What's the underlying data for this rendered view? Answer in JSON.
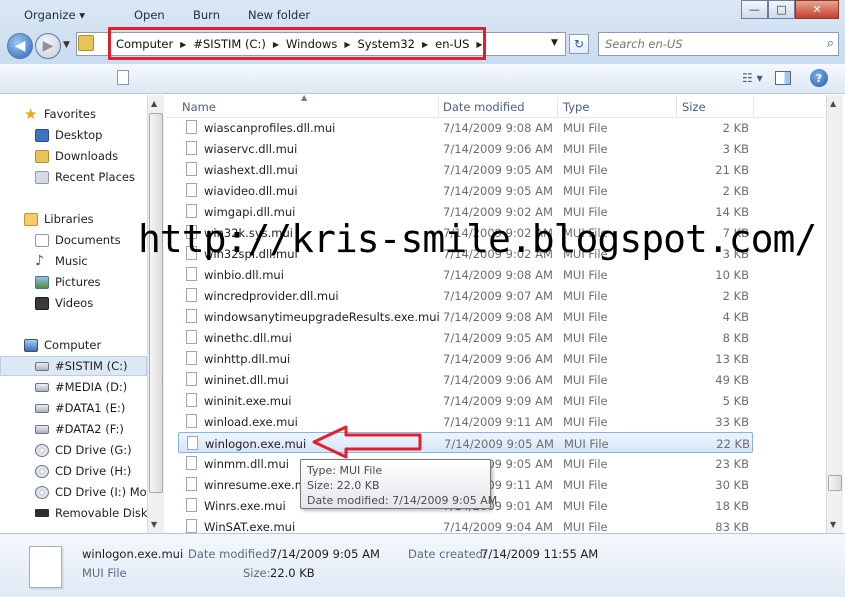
{
  "window": {
    "minimize_glyph": "—",
    "maximize_glyph": "□",
    "close_glyph": "✕"
  },
  "address": {
    "crumbs": [
      "Computer",
      "#SISTIM (C:)",
      "Windows",
      "System32",
      "en-US"
    ],
    "highlight_color": "#e0202c"
  },
  "search": {
    "placeholder": "Search en-US"
  },
  "toolbar": {
    "organize": "Organize",
    "organize_arrow": "▾",
    "open": "Open",
    "burn": "Burn",
    "new_folder": "New folder",
    "help": "?"
  },
  "nav": {
    "favorites": "Favorites",
    "desktop": "Desktop",
    "downloads": "Downloads",
    "recent_places": "Recent Places",
    "libraries": "Libraries",
    "documents": "Documents",
    "music": "Music",
    "pictures": "Pictures",
    "videos": "Videos",
    "computer": "Computer",
    "drive_c": "#SISTIM (C:)",
    "drive_d": "#MEDIA (D:)",
    "drive_e": "#DATA1 (E:)",
    "drive_f": "#DATA2 (F:)",
    "drive_g": "CD Drive (G:)",
    "drive_h": "CD Drive (H:)",
    "drive_i": "CD Drive (I:) Moc",
    "removable": "Removable Disk ("
  },
  "columns": {
    "name": "Name",
    "date_modified": "Date modified",
    "type": "Type",
    "size": "Size"
  },
  "files": [
    {
      "name": "wiascanprofiles.dll.mui",
      "date": "7/14/2009 9:08 AM",
      "type": "MUI File",
      "size": "2 KB"
    },
    {
      "name": "wiaservc.dll.mui",
      "date": "7/14/2009 9:06 AM",
      "type": "MUI File",
      "size": "3 KB"
    },
    {
      "name": "wiashext.dll.mui",
      "date": "7/14/2009 9:05 AM",
      "type": "MUI File",
      "size": "21 KB"
    },
    {
      "name": "wiavideo.dll.mui",
      "date": "7/14/2009 9:05 AM",
      "type": "MUI File",
      "size": "2 KB"
    },
    {
      "name": "wimgapi.dll.mui",
      "date": "7/14/2009 9:02 AM",
      "type": "MUI File",
      "size": "14 KB"
    },
    {
      "name": "win32k.sys.mui",
      "date": "7/14/2009 9:02 AM",
      "type": "MUI File",
      "size": "7 KB"
    },
    {
      "name": "win32spl.dll.mui",
      "date": "7/14/2009 9:02 AM",
      "type": "MUI File",
      "size": "3 KB"
    },
    {
      "name": "winbio.dll.mui",
      "date": "7/14/2009 9:08 AM",
      "type": "MUI File",
      "size": "10 KB"
    },
    {
      "name": "wincredprovider.dll.mui",
      "date": "7/14/2009 9:07 AM",
      "type": "MUI File",
      "size": "2 KB"
    },
    {
      "name": "windowsanytimeupgradeResults.exe.mui",
      "date": "7/14/2009 9:08 AM",
      "type": "MUI File",
      "size": "4 KB"
    },
    {
      "name": "winethc.dll.mui",
      "date": "7/14/2009 9:05 AM",
      "type": "MUI File",
      "size": "8 KB"
    },
    {
      "name": "winhttp.dll.mui",
      "date": "7/14/2009 9:06 AM",
      "type": "MUI File",
      "size": "13 KB"
    },
    {
      "name": "wininet.dll.mui",
      "date": "7/14/2009 9:06 AM",
      "type": "MUI File",
      "size": "49 KB"
    },
    {
      "name": "wininit.exe.mui",
      "date": "7/14/2009 9:09 AM",
      "type": "MUI File",
      "size": "5 KB"
    },
    {
      "name": "winload.exe.mui",
      "date": "7/14/2009 9:11 AM",
      "type": "MUI File",
      "size": "33 KB"
    },
    {
      "name": "winlogon.exe.mui",
      "date": "7/14/2009 9:05 AM",
      "type": "MUI File",
      "size": "22 KB"
    },
    {
      "name": "winmm.dll.mui",
      "date": "7/14/2009 9:05 AM",
      "type": "MUI File",
      "size": "23 KB"
    },
    {
      "name": "winresume.exe.mui",
      "date": "7/14/2009 9:11 AM",
      "type": "MUI File",
      "size": "30 KB"
    },
    {
      "name": "Winrs.exe.mui",
      "date": "7/14/2009 9:01 AM",
      "type": "MUI File",
      "size": "18 KB"
    },
    {
      "name": "WinSAT.exe.mui",
      "date": "7/14/2009 9:04 AM",
      "type": "MUI File",
      "size": "83 KB"
    }
  ],
  "tooltip": {
    "type": "Type: MUI File",
    "size": "Size: 22.0 KB",
    "date": "Date modified: 7/14/2009 9:05 AM"
  },
  "watermark": "http://kris-smile.blogspot.com/",
  "details": {
    "filename": "winlogon.exe.mui",
    "filetype": "MUI File",
    "date_modified_label": "Date modified:",
    "date_modified": "7/14/2009 9:05 AM",
    "date_created_label": "Date created:",
    "date_created": "7/14/2009 11:55 AM",
    "size_label": "Size:",
    "size": "22.0 KB"
  }
}
